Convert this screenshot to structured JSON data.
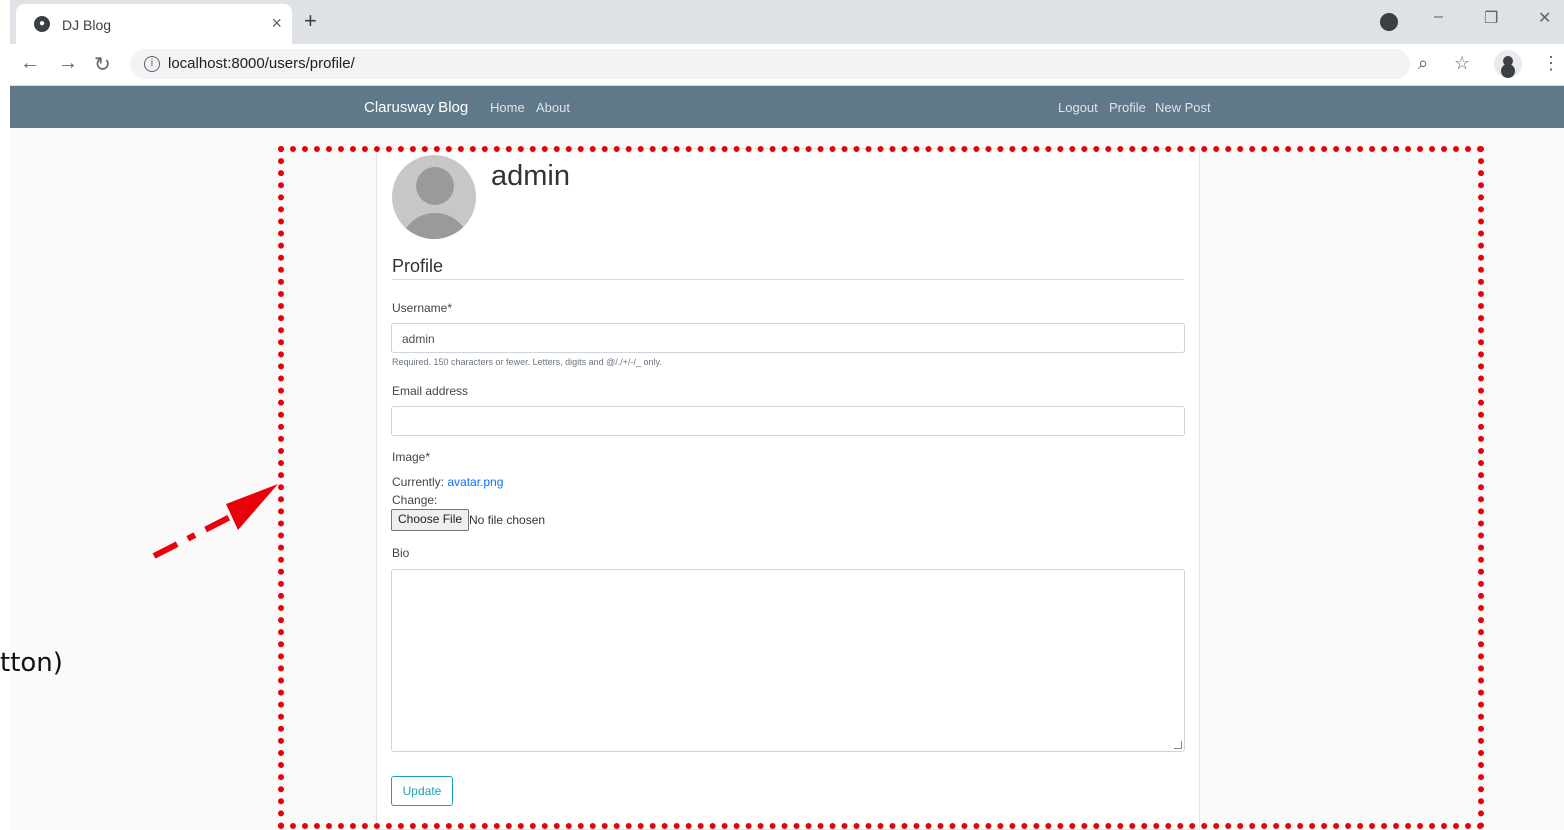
{
  "slide": {
    "side_text": "tton)"
  },
  "browser": {
    "tab_title": "DJ Blog",
    "tab_close": "×",
    "new_tab": "+",
    "url": "localhost:8000/users/profile/",
    "window_controls": [
      "–",
      "❐",
      "✕"
    ],
    "nav_icons": [
      "arrow-left-icon",
      "arrow-right-icon",
      "reload-icon"
    ],
    "right_icons": [
      "zoom-icon",
      "star-icon",
      "profile-icon",
      "menu-icon"
    ]
  },
  "navbar": {
    "brand": "Clarusway Blog",
    "left_links": [
      "Home",
      "About"
    ],
    "right_links": [
      "Logout",
      "Profile",
      "New Post"
    ],
    "color": "#5f788a"
  },
  "profile": {
    "username_heading": "admin",
    "legend": "Profile",
    "username_label": "Username*",
    "username_value": "admin",
    "username_help": "Required. 150 characters or fewer. Letters, digits and @/./+/-/_ only.",
    "email_label": "Email address",
    "email_value": "",
    "image_label": "Image*",
    "currently_label": "Currently:",
    "currently_file": "avatar.png",
    "change_label": "Change:",
    "choose_file": "Choose File",
    "file_status": "No file chosen",
    "bio_label": "Bio",
    "bio_value": "",
    "submit": "Update"
  },
  "annotation": {
    "color": "#e8000b"
  }
}
